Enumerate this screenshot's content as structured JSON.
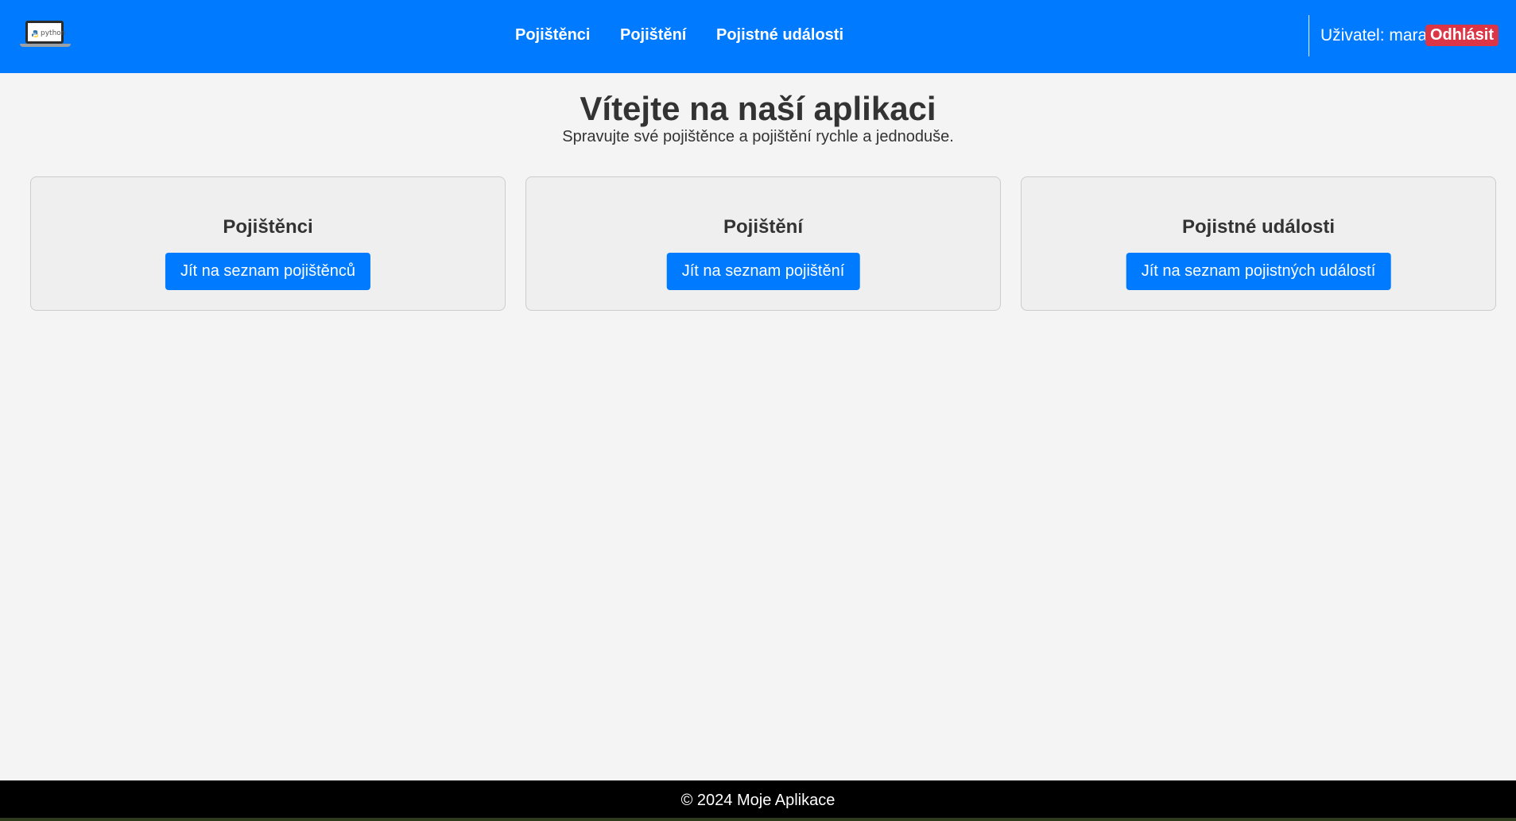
{
  "navbar": {
    "logo": {
      "icon": "python-laptop-logo-icon",
      "word": "python"
    },
    "links": [
      {
        "label": "Pojištěnci"
      },
      {
        "label": "Pojištění"
      },
      {
        "label": "Pojistné události"
      }
    ],
    "user_label": "Uživatel: mara",
    "logout_label": "Odhlásit",
    "color": "#007bff",
    "logout_color": "#dc3545"
  },
  "hero": {
    "title": "Vítejte na naší aplikaci",
    "subtitle": "Spravujte své pojištěnce a pojištění rychle a jednoduše."
  },
  "cards": [
    {
      "title": "Pojištěnci",
      "button": "Jít na seznam pojištěnců"
    },
    {
      "title": "Pojištění",
      "button": "Jít na seznam pojištění"
    },
    {
      "title": "Pojistné události",
      "button": "Jít na seznam pojistných událostí"
    }
  ],
  "footer": {
    "text": "© 2024 Moje Aplikace"
  }
}
